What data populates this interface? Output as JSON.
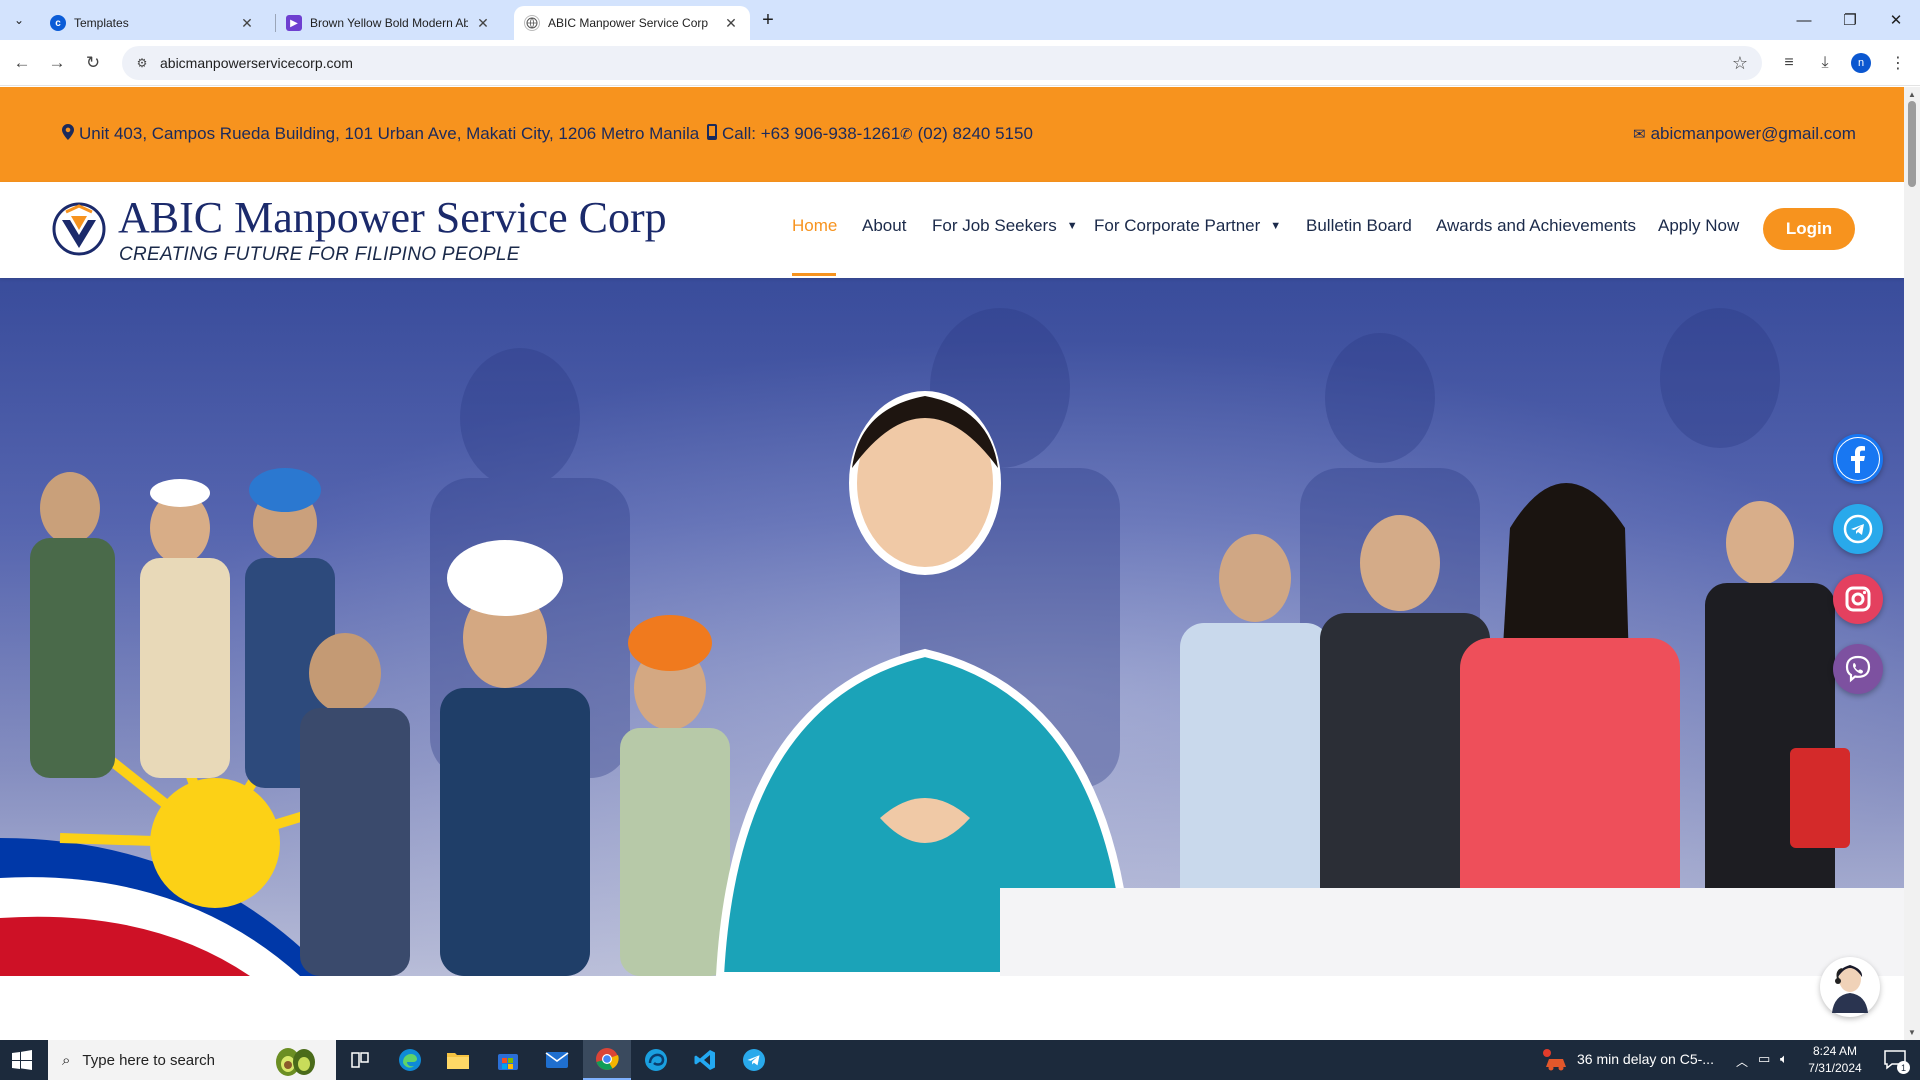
{
  "browser": {
    "tabs": [
      {
        "title": "Templates",
        "active": false
      },
      {
        "title": "Brown Yellow Bold Modern Abstract",
        "active": false
      },
      {
        "title": "ABIC Manpower Service Corp",
        "active": true
      }
    ],
    "url": "abicmanpowerservicecorp.com",
    "profile_initial": "n"
  },
  "topbar": {
    "address": "Unit 403, Campos Rueda Building, 101 Urban Ave, Makati City, 1206 Metro Manila",
    "call": "Call: +63 906-938-1261",
    "landline": "(02) 8240 5150",
    "email": "abicmanpower@gmail.com"
  },
  "header": {
    "brand": "ABIC Manpower Service Corp",
    "tagline": "CREATING FUTURE FOR FILIPINO PEOPLE",
    "nav": [
      "Home",
      "About",
      "For Job Seekers",
      "For Corporate Partner",
      "Bulletin Board",
      "Awards and Achievements",
      "Apply Now"
    ],
    "active_nav": "Home",
    "login": "Login"
  },
  "social": [
    "facebook-icon",
    "telegram-icon",
    "instagram-icon",
    "viber-icon"
  ],
  "colors": {
    "accent": "#f7931e",
    "brand_navy": "#1b2a6b",
    "facebook": "#1877f2",
    "telegram": "#29a9eb",
    "instagram": "#e4405f",
    "viber": "#7d51a0"
  },
  "taskbar": {
    "search_placeholder": "Type here to search",
    "notification": "36 min delay on C5-...",
    "time": "8:24 AM",
    "date": "7/31/2024",
    "notif_count": "1"
  }
}
